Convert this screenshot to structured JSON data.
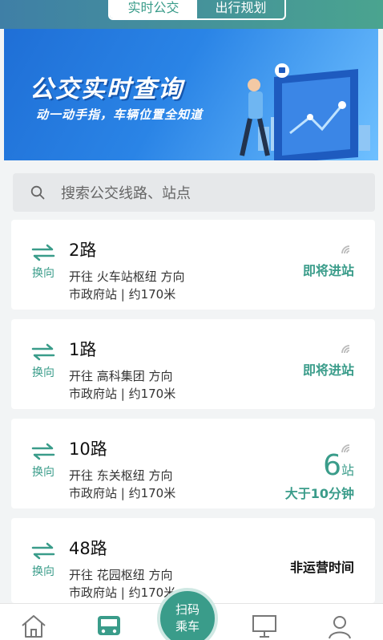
{
  "tabs": [
    {
      "label": "实时公交",
      "active": true
    },
    {
      "label": "出行规划",
      "active": false
    }
  ],
  "banner": {
    "title": "公交实时查询",
    "subtitle": "动一动手指，车辆位置全知道"
  },
  "search": {
    "placeholder": "搜索公交线路、站点"
  },
  "routes": [
    {
      "name": "2路",
      "swap_label": "换向",
      "direction": "开往 火车站枢纽 方向",
      "stop": "市政府站 | 约170米",
      "status": "即将进站"
    },
    {
      "name": "1路",
      "swap_label": "换向",
      "direction": "开往 高科集团 方向",
      "stop": "市政府站 | 约170米",
      "status": "即将进站"
    },
    {
      "name": "10路",
      "swap_label": "换向",
      "direction": "开往 东关枢纽 方向",
      "stop": "市政府站 | 约170米",
      "stations_count": "6",
      "stations_unit": "站",
      "status": "大于10分钟"
    },
    {
      "name": "48路",
      "swap_label": "换向",
      "direction": "开往 花园枢纽 方向",
      "stop": "市政府站 | 约170米",
      "status": "非运营时间"
    }
  ],
  "bottom_nav": {
    "scan_line1": "扫码",
    "scan_line2": "乘车",
    "items": [
      "home-icon",
      "bus-icon",
      "monitor-icon",
      "profile-icon"
    ]
  },
  "colors": {
    "accent": "#3a9c8a",
    "banner": "#2a84e6"
  }
}
